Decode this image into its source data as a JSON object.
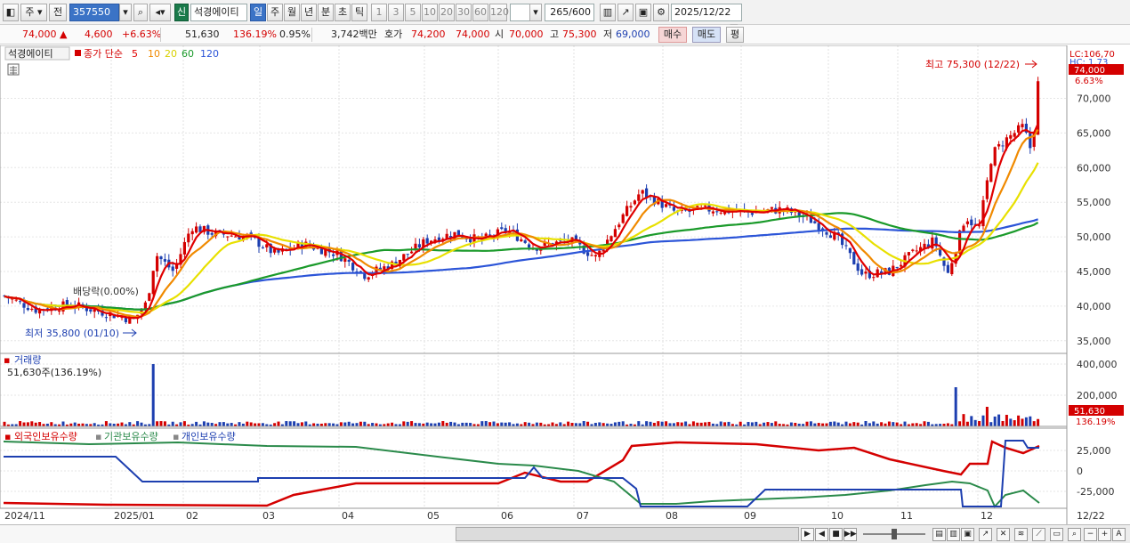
{
  "toolbar": {
    "market_type": "주",
    "market_prefix": "전",
    "stock_code": "357550",
    "credit_badge": "신",
    "stock_name": "석경에이티",
    "periods": [
      "일",
      "주",
      "월",
      "년",
      "분",
      "초",
      "틱"
    ],
    "active_period": "일",
    "intervals": [
      "1",
      "3",
      "5",
      "10",
      "20",
      "30",
      "60",
      "120"
    ],
    "count_display": "265",
    "count_total": "/600",
    "date": "2025/12/22"
  },
  "info": {
    "price": "74,000",
    "change": "4,600",
    "change_pct": "+6.63%",
    "volume": "51,630",
    "volume_ratio": "136.19%",
    "turnover": "0.95%",
    "trade_value": "3,742백만",
    "quote_label": "호가",
    "ask": "74,200",
    "bid": "74,000",
    "open_label": "시",
    "open": "70,000",
    "high_label": "고",
    "high": "75,300",
    "low_label": "저",
    "low": "69,000",
    "buy_label": "매수",
    "sell_label": "매도",
    "eval_label": "평"
  },
  "legend": {
    "name": "석경에이티",
    "ma_prefix": "종가 단순",
    "ma_periods": [
      {
        "label": "5",
        "color": "#e00000"
      },
      {
        "label": "10",
        "color": "#f08a00"
      },
      {
        "label": "20",
        "color": "#e8e000"
      },
      {
        "label": "60",
        "color": "#1a9a2a"
      },
      {
        "label": "120",
        "color": "#2c55d8"
      }
    ],
    "lc": "LC:106,70",
    "hc": "HC: 1.73"
  },
  "price_axis": [
    "70,000",
    "65,000",
    "60,000",
    "55,000",
    "50,000",
    "45,000",
    "40,000",
    "35,000"
  ],
  "current_price_tag": "74,000",
  "current_pct_tag": "6.63%",
  "annotations": {
    "high": "최고 75,300 (12/22)",
    "low": "최저 35,800 (01/10)",
    "dividend": "배당락(0.00%)"
  },
  "volume_panel": {
    "title": "거래량",
    "current": "51,630주(136.19%)",
    "axis": [
      "400,000",
      "200,000"
    ],
    "tag_value": "51,630",
    "tag_pct": "136.19%"
  },
  "holdings_panel": {
    "legend": [
      {
        "label": "외국인보유수량",
        "color": "#d40000"
      },
      {
        "label": "기관보유수량",
        "color": "#2a8a4a"
      },
      {
        "label": "개인보유수량",
        "color": "#1d3fb0"
      }
    ],
    "axis": [
      "25,000",
      "0",
      "-25,000"
    ]
  },
  "x_labels": [
    "2024/11",
    "2025/01",
    "02",
    "03",
    "04",
    "05",
    "06",
    "07",
    "08",
    "09",
    "10",
    "11",
    "12",
    "12/22"
  ],
  "colors": {
    "up": "#d40000",
    "down": "#1d3fb0",
    "accent": "#3b73c6"
  }
}
